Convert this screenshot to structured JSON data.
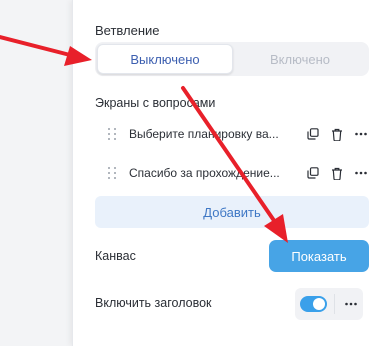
{
  "branching": {
    "label": "Ветвление",
    "options": [
      "Выключено",
      "Включено"
    ],
    "selected": "Выключено"
  },
  "screens": {
    "label": "Экраны с вопросами",
    "items": [
      {
        "title": "Выберите планировку ва..."
      },
      {
        "title": "Спасибо за прохождение..."
      }
    ],
    "add_label": "Добавить"
  },
  "canvas": {
    "label": "Канвас",
    "show_label": "Показать"
  },
  "header_toggle": {
    "label": "Включить заголовок",
    "enabled": true
  },
  "icons": {
    "drag": "drag-handle-icon",
    "copy": "copy-icon",
    "delete": "trash-icon",
    "more": "more-horizontal-icon"
  },
  "colors": {
    "accent": "#47a4e6",
    "annotation_arrow": "#e8202a"
  }
}
